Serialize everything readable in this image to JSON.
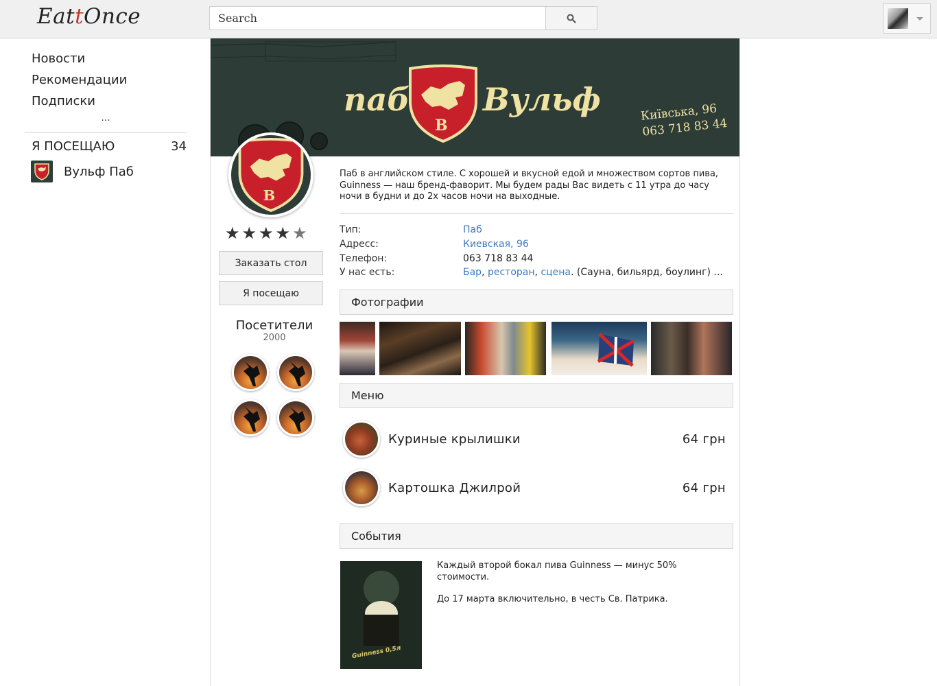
{
  "app": {
    "logo_part1": "Eat",
    "logo_part2": "Once",
    "accent_color": "#c0392b"
  },
  "search": {
    "placeholder": "Search"
  },
  "sidebar": {
    "items": [
      {
        "label": "Новости"
      },
      {
        "label": "Рекомендации"
      },
      {
        "label": "Подписки"
      }
    ],
    "more_label": "...",
    "visiting_label": "Я ПОСЕЩАЮ",
    "visiting_count": "34",
    "visiting_places": [
      {
        "label": "Вульф Паб"
      }
    ]
  },
  "banner": {
    "word_left": "паб",
    "word_right": "Вульф",
    "address_line": "Київська, 96",
    "phone_line": "063 718 83 44",
    "background_color": "#2d3c37",
    "text_color": "#efe2a3"
  },
  "venue": {
    "rating": 4,
    "rating_max": 5,
    "reserve_label": "Заказать стол",
    "visiting_btn_label": "Я посещаю",
    "visitors_title": "Посетители",
    "visitors_count": "2000",
    "description": "Паб в английском стиле. С хорошей и вкусной едой и множеством сортов пива, Guinness — наш бренд-фаворит. Мы будем рады Вас видеть с 11 утра до часу ночи в будни и до 2х часов ночи на выходные."
  },
  "info": {
    "type_label": "Тип:",
    "type_value": "Паб",
    "address_label": "Адресс:",
    "address_value": "Киевская, 96",
    "phone_label": "Телефон:",
    "phone_value": "063 718 83 44",
    "features_label": "У нас есть:",
    "features_links": [
      "Бар",
      "ресторан",
      "сцена"
    ],
    "features_sep": ", ",
    "features_rest": ". (Сауна, бильярд, боулинг) ..."
  },
  "sections": {
    "photos": "Фотографии",
    "menu": "Меню",
    "events": "События"
  },
  "menu": [
    {
      "name": "Куриные крылишки",
      "price": "64 грн"
    },
    {
      "name": "Картошка Джилрой",
      "price": "64 грн"
    }
  ],
  "event": {
    "line1": "Каждый второй бокал пива Guinness — минус 50% стоимости.",
    "line2": "До 17 марта включительно, в честь Св. Патрика."
  }
}
